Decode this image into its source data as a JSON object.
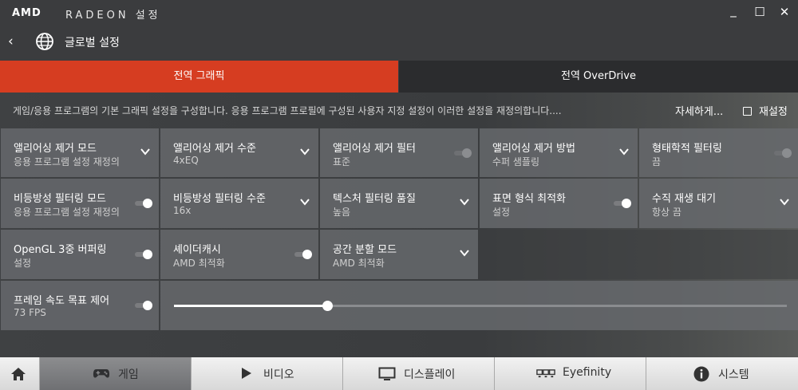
{
  "titlebar": {
    "logo": "AMD",
    "title": "RADEON 설정",
    "minimize": "_",
    "maximize": "☐",
    "close": "✕"
  },
  "nav": {
    "back": "‹",
    "title": "글로벌 설정"
  },
  "tabs": [
    {
      "label": "전역 그래픽",
      "active": true
    },
    {
      "label": "전역 OverDrive",
      "active": false
    }
  ],
  "description": "게임/응용 프로그램의 기본 그래픽 설정을 구성합니다. 응용 프로그램 프로필에 구성된 사용자 지정 설정이 이러한 설정을 재정의합니다....",
  "more_label": "자세하게...",
  "reset_label": "재설정",
  "settings": {
    "aa_mode": {
      "title": "앨리어싱 제거 모드",
      "value": "응용 프로그램 설정 재정의"
    },
    "aa_level": {
      "title": "앨리어싱 제거 수준",
      "value": "4xEQ"
    },
    "aa_filter": {
      "title": "앨리어싱 제거 필터",
      "value": "표준",
      "toggle": "off"
    },
    "aa_method": {
      "title": "앨리어싱 제거 방법",
      "value": "수퍼 샘플링"
    },
    "morph_filter": {
      "title": "형태학적 필터링",
      "value": "끔",
      "toggle": "off"
    },
    "aniso_mode": {
      "title": "비등방성 필터링 모드",
      "value": "응용 프로그램 설정 재정의",
      "toggle": "on"
    },
    "aniso_level": {
      "title": "비등방성 필터링 수준",
      "value": "16x"
    },
    "tex_quality": {
      "title": "텍스처 필터링 품질",
      "value": "높음"
    },
    "surface_opt": {
      "title": "표면 형식 최적화",
      "value": "설정",
      "toggle": "on"
    },
    "vsync": {
      "title": "수직 재생 대기",
      "value": "항상 끔"
    },
    "triple_buffer": {
      "title": "OpenGL 3중 버퍼링",
      "value": "설정",
      "toggle": "on"
    },
    "shader_cache": {
      "title": "셰이더캐시",
      "value": "AMD 최적화",
      "toggle": "on"
    },
    "tessellation": {
      "title": "공간 분할 모드",
      "value": "AMD 최적화"
    },
    "frtc": {
      "title": "프레임 속도 목표 제어",
      "value": "73 FPS",
      "toggle": "on",
      "slider_fraction": 0.25
    }
  },
  "bottom_tabs": [
    {
      "label": "",
      "icon": "home-icon"
    },
    {
      "label": "게임",
      "icon": "gamepad-icon",
      "selected": true
    },
    {
      "label": "비디오",
      "icon": "play-icon"
    },
    {
      "label": "디스플레이",
      "icon": "monitor-icon"
    },
    {
      "label": "Eyefinity",
      "icon": "eyefinity-icon"
    },
    {
      "label": "시스템",
      "icon": "info-icon"
    }
  ],
  "colors": {
    "accent": "#d63d21",
    "tile": "#686a6e",
    "tab_inactive": "#2b2c2e"
  }
}
